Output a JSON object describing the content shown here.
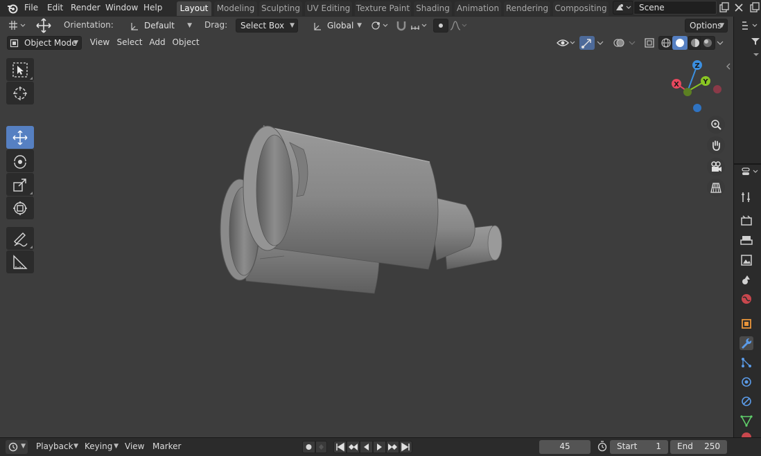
{
  "menu": [
    "File",
    "Edit",
    "Render",
    "Window",
    "Help"
  ],
  "workspaces": [
    {
      "label": "Layout",
      "active": true
    },
    {
      "label": "Modeling",
      "active": false
    },
    {
      "label": "Sculpting",
      "active": false
    },
    {
      "label": "UV Editing",
      "active": false
    },
    {
      "label": "Texture Paint",
      "active": false
    },
    {
      "label": "Shading",
      "active": false
    },
    {
      "label": "Animation",
      "active": false
    },
    {
      "label": "Rendering",
      "active": false
    },
    {
      "label": "Compositing",
      "active": false
    }
  ],
  "scene": {
    "name": "Scene"
  },
  "tool_settings": {
    "orientation_label": "Orientation:",
    "orientation_value": "Default",
    "drag_label": "Drag:",
    "drag_value": "Select Box",
    "transform_orientation": "Global",
    "options_label": "Options"
  },
  "view_header": {
    "mode": "Object Mode",
    "menus": [
      "View",
      "Select",
      "Add",
      "Object"
    ]
  },
  "gizmo_axes": {
    "x": "X",
    "y": "Y",
    "z": "Z"
  },
  "toolbar_tools": [
    "select-box",
    "cursor",
    "move",
    "rotate",
    "scale",
    "transform",
    "annotate",
    "measure"
  ],
  "active_tool": "move",
  "timeline": {
    "playback_label": "Playback",
    "keying_label": "Keying",
    "view_label": "View",
    "marker_label": "Marker",
    "current_frame": "45",
    "start_label": "Start",
    "start_value": "1",
    "end_label": "End",
    "end_value": "250"
  },
  "colors": {
    "accent": "#5680c2",
    "axis_x": "#e8485e",
    "axis_y": "#8ac623",
    "axis_z": "#3b8fe0",
    "viewport_bg": "#3d3d3d",
    "panel_bg": "#2b2b2b"
  }
}
